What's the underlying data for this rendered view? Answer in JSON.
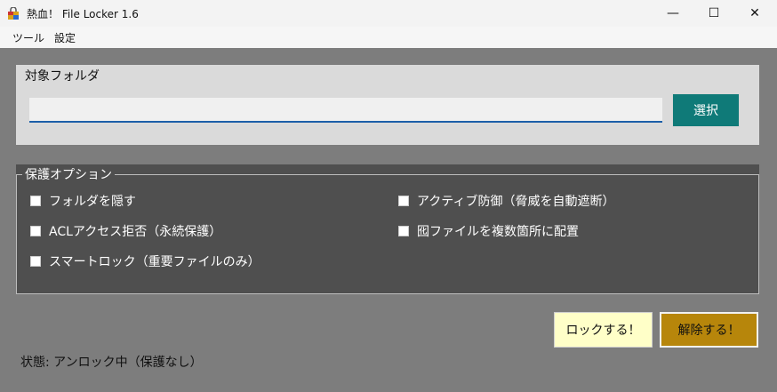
{
  "window": {
    "title": "熱血！ File Locker 1.6",
    "minimize_glyph": "—",
    "maximize_glyph": "☐",
    "close_glyph": "✕"
  },
  "menu": [
    {
      "label": "ツール"
    },
    {
      "label": "設定"
    }
  ],
  "folder": {
    "label": "対象フォルダ",
    "path_value": "",
    "select_button": "選択"
  },
  "options": {
    "legend": "保護オプション",
    "items": [
      {
        "label": "フォルダを隠す",
        "checked": false
      },
      {
        "label": "アクティブ防御（脅威を自動遮断）",
        "checked": false
      },
      {
        "label": "ACLアクセス拒否（永続保護）",
        "checked": false
      },
      {
        "label": "囮ファイルを複数箇所に配置",
        "checked": false
      },
      {
        "label": "スマートロック（重要ファイルのみ）",
        "checked": false
      }
    ]
  },
  "actions": {
    "lock_label": "ロックする！",
    "unlock_label": "解除する！"
  },
  "status": {
    "text": "状態: アンロック中（保護なし）"
  },
  "colors": {
    "accent_select": "#0f7a78",
    "lock_bg": "#ffffc8",
    "unlock_bg": "#b7860b",
    "background": "#7d7d7d"
  },
  "icons": {
    "app": "padlock-app-icon"
  }
}
